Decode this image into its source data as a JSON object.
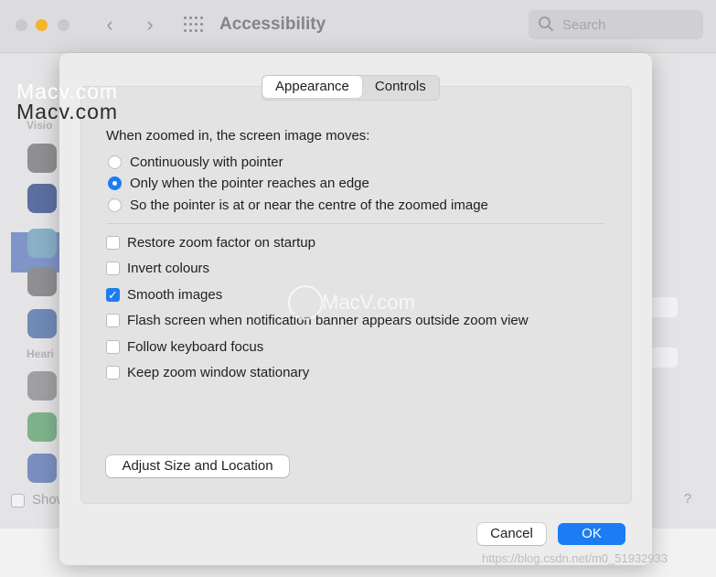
{
  "window": {
    "title": "Accessibility",
    "search_placeholder": "Search",
    "back_glyph": "‹",
    "forward_glyph": "›"
  },
  "sidebar": {
    "section_vision": "Visio",
    "section_hearing": "Heari",
    "show_label": "Show",
    "icons": [
      "accessibility-overview-icon",
      "zoom-icon",
      "display-icon",
      "spoken-content-icon",
      "descriptions-icon",
      "audio-icon",
      "rtt-icon",
      "captions-icon"
    ]
  },
  "background_buttons": {
    "button1": "...",
    "button2": "..."
  },
  "watermark": {
    "line1": "Macv.com",
    "line2": "Macv.com",
    "center": "MacV.com",
    "footer": "https://blog.csdn.net/m0_51932933"
  },
  "sheet": {
    "tabs": {
      "appearance": "Appearance",
      "controls": "Controls"
    },
    "heading": "When zoomed in, the screen image moves:",
    "radios": [
      {
        "label": "Continuously with pointer",
        "selected": false
      },
      {
        "label": "Only when the pointer reaches an edge",
        "selected": true
      },
      {
        "label": "So the pointer is at or near the centre of the zoomed image",
        "selected": false
      }
    ],
    "checkboxes": [
      {
        "label": "Restore zoom factor on startup",
        "checked": false
      },
      {
        "label": "Invert colours",
        "checked": false
      },
      {
        "label": "Smooth images",
        "checked": true
      },
      {
        "label": "Flash screen when notification banner appears outside zoom view",
        "checked": false
      },
      {
        "label": "Follow keyboard focus",
        "checked": false
      },
      {
        "label": "Keep zoom window stationary",
        "checked": false
      }
    ],
    "adjust_button": "Adjust Size and Location",
    "cancel_button": "Cancel",
    "ok_button": "OK",
    "check_glyph": "✓"
  },
  "colors": {
    "accent": "#1c7cf4",
    "traffic_yellow": "#f3b52b"
  }
}
